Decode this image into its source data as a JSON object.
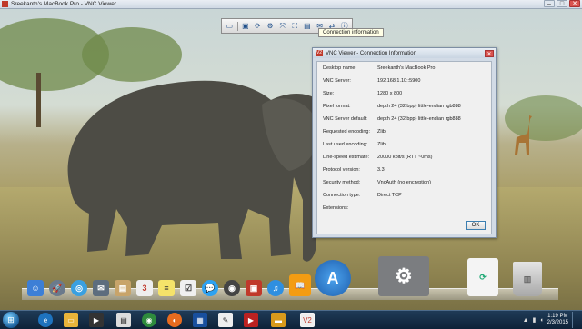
{
  "window": {
    "title": "Sreekanth's MacBook Pro - VNC Viewer",
    "controls": [
      "–",
      "□",
      "✕"
    ]
  },
  "toolbar": {
    "tooltip": "Connection information"
  },
  "dialog": {
    "title": "VNC Viewer - Connection Information",
    "rows": [
      {
        "label": "Desktop name:",
        "value": "Sreekanth's MacBook Pro"
      },
      {
        "label": "VNC Server:",
        "value": "192.168.1.10::5900"
      },
      {
        "label": "Size:",
        "value": "1280 x 800"
      },
      {
        "label": "Pixel format:",
        "value": "depth 24 (32 bpp) little-endian rgb888"
      },
      {
        "label": "VNC Server default:",
        "value": "depth 24 (32 bpp) little-endian rgb888"
      },
      {
        "label": "Requested encoding:",
        "value": "Zlib"
      },
      {
        "label": "Last used encoding:",
        "value": "Zlib"
      },
      {
        "label": "Line-speed estimate:",
        "value": "20000 kbit/s (RTT ~0ms)"
      },
      {
        "label": "Protocol version:",
        "value": "3.3"
      },
      {
        "label": "Security method:",
        "value": "VncAuth (no encryption)"
      },
      {
        "label": "Connection type:",
        "value": "Direct TCP"
      },
      {
        "label": "Extensions:",
        "value": ""
      }
    ],
    "ok_label": "OK"
  },
  "dock": {
    "calendar_day": "3"
  },
  "taskbar": {
    "time": "1:19 PM",
    "date": "2/3/2015"
  }
}
